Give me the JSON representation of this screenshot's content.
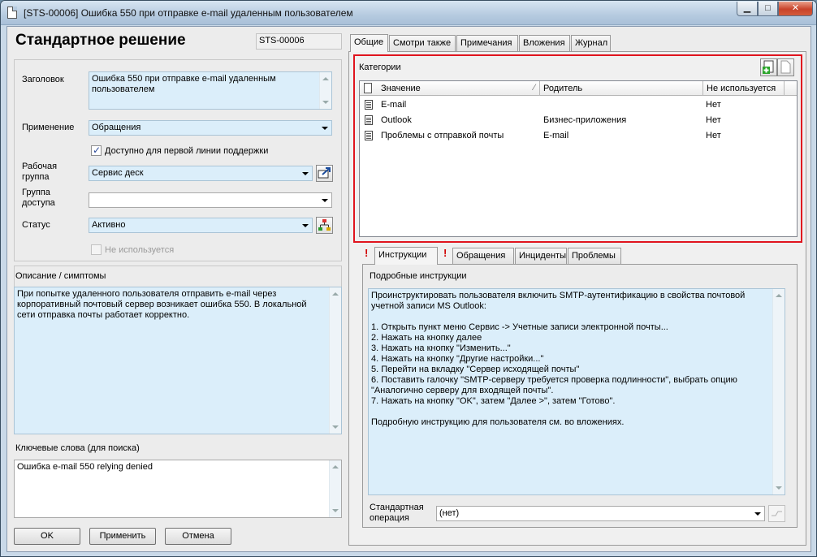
{
  "window": {
    "title": "[STS-00006] Ошибка 550 при отправке e-mail удаленным пользователем",
    "min_glyph": "▁",
    "max_glyph": "□",
    "close_glyph": "✕"
  },
  "header": {
    "heading": "Стандартное решение",
    "code": "STS-00006"
  },
  "form": {
    "subject_label": "Заголовок",
    "subject_value": "Ошибка 550 при отправке e-mail удаленным пользователем",
    "application_label": "Применение",
    "application_value": "Обращения",
    "first_line_label": "Доступно для первой линии поддержки",
    "first_line_checked": true,
    "workgroup_label_1": "Рабочая",
    "workgroup_label_2": "группа",
    "workgroup_value": "Сервис деск",
    "access_label_1": "Группа",
    "access_label_2": "доступа",
    "access_value": "",
    "status_label": "Статус",
    "status_value": "Активно",
    "not_used_label": "Не используется",
    "description_label": "Описание / симптомы",
    "description_value": "При попытке удаленного пользователя отправить e-mail через корпоративный почтовый сервер возникает ошибка 550. В локальной сети отправка почты работает корректно.",
    "keywords_label": "Ключевые слова (для поиска)",
    "keywords_value": "Ошибка e-mail 550 relying denied"
  },
  "buttons": {
    "ok": "OK",
    "apply": "Применить",
    "cancel": "Отмена"
  },
  "tabs": [
    {
      "label": "Общие"
    },
    {
      "label": "Смотри также"
    },
    {
      "label": "Примечания"
    },
    {
      "label": "Вложения"
    },
    {
      "label": "Журнал"
    }
  ],
  "categories": {
    "label": "Категории",
    "columns": [
      "Значение",
      "Родитель",
      "Не используется"
    ],
    "rows": [
      {
        "value": "E-mail",
        "parent": "",
        "unused": "Нет"
      },
      {
        "value": "Outlook",
        "parent": "Бизнес-приложения",
        "unused": "Нет"
      },
      {
        "value": "Проблемы с отправкой почты",
        "parent": "E-mail",
        "unused": "Нет"
      }
    ]
  },
  "subtabs": [
    {
      "label": "Инструкции",
      "flag": "!"
    },
    {
      "label": "Обращения",
      "flag": "!"
    },
    {
      "label": "Инциденты",
      "flag": ""
    },
    {
      "label": "Проблемы",
      "flag": ""
    }
  ],
  "instructions": {
    "label": "Подробные инструкции",
    "lines": [
      "Проинструктировать пользователя включить SMTP-аутентификацию в свойства почтовой",
      "учетной записи MS Outlook:",
      "",
      "1. Открыть пункт меню Сервис -> Учетные записи электронной почты...",
      "2. Нажать на кнопку далее",
      "3. Нажать на кнопку \"Изменить...\"",
      "4. Нажать на кнопку \"Другие настройки...\"",
      "5. Перейти на вкладку \"Сервер исходящей почты\"",
      "6. Поставить галочку \"SMTP-серверу требуется проверка подлинности\", выбрать опцию",
      "\"Аналогично серверу для входящей почты\".",
      "7. Нажать на кнопку \"OK\", затем \"Далее >\", затем \"Готово\".",
      "",
      "Подробную инструкцию для пользователя см. во вложениях."
    ],
    "std_op_label_1": "Стандартная",
    "std_op_label_2": "операция",
    "std_op_value": "(нет)"
  }
}
